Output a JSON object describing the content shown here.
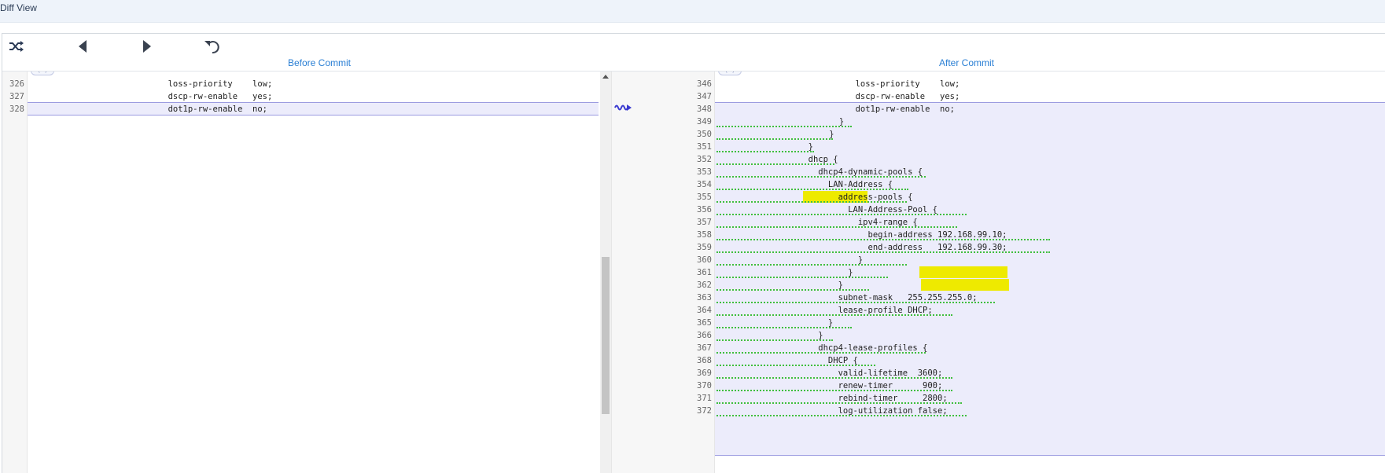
{
  "window": {
    "title": "Diff View"
  },
  "toolbar": {
    "shuffle_icon": "shuffle-icon",
    "prev_icon": "triangle-left-icon",
    "next_icon": "triangle-right-icon",
    "undo_icon": "undo-icon"
  },
  "panes": {
    "before": {
      "title": "Before Commit",
      "fold_label": "(...)"
    },
    "after": {
      "title": "After Commit",
      "fold_label": "(...)"
    }
  },
  "connector_icon": "wavy-arrow-icon",
  "before_lines": [
    {
      "num": "326",
      "text": "        loss-priority    low;"
    },
    {
      "num": "327",
      "text": "        dscp-rw-enable   yes;"
    },
    {
      "num": "328",
      "text": "        dot1p-rw-enable  no;"
    }
  ],
  "after_lines": [
    {
      "num": "346",
      "text": "        loss-priority    low;"
    },
    {
      "num": "347",
      "text": "        dscp-rw-enable   yes;"
    },
    {
      "num": "348",
      "text": "        dot1p-rw-enable  no;"
    },
    {
      "num": "349",
      "text": "      }"
    },
    {
      "num": "350",
      "text": "    }"
    },
    {
      "num": "351",
      "text": "  }"
    },
    {
      "num": "352",
      "text": "  dhcp {"
    },
    {
      "num": "353",
      "text": "    dhcp4-dynamic-pools {"
    },
    {
      "num": "354",
      "text": "      LAN-Address {"
    },
    {
      "num": "355",
      "text": "        address-pools {"
    },
    {
      "num": "356",
      "text": "          LAN-Address-Pool {"
    },
    {
      "num": "357",
      "text": "            ipv4-range {"
    },
    {
      "num": "358",
      "text": "              begin-address 192.168.99.10;"
    },
    {
      "num": "359",
      "text": "              end-address   192.168.99.30;"
    },
    {
      "num": "360",
      "text": "            }"
    },
    {
      "num": "361",
      "text": "          }"
    },
    {
      "num": "362",
      "text": "        }"
    },
    {
      "num": "363",
      "text": "        subnet-mask   255.255.255.0;"
    },
    {
      "num": "364",
      "text": "        lease-profile DHCP;"
    },
    {
      "num": "365",
      "text": "      }"
    },
    {
      "num": "366",
      "text": "    }"
    },
    {
      "num": "367",
      "text": "    dhcp4-lease-profiles {"
    },
    {
      "num": "368",
      "text": "      DHCP {"
    },
    {
      "num": "369",
      "text": "        valid-lifetime  3600;"
    },
    {
      "num": "370",
      "text": "        renew-timer      900;"
    },
    {
      "num": "371",
      "text": "        rebind-timer     2800;"
    },
    {
      "num": "372",
      "text": "        log-utilization false;"
    }
  ],
  "colors": {
    "accent": "#2a7fd4",
    "changed_bg": "#ececfb",
    "added_underline": "#3fbf3f",
    "highlight": "#eeea00"
  }
}
